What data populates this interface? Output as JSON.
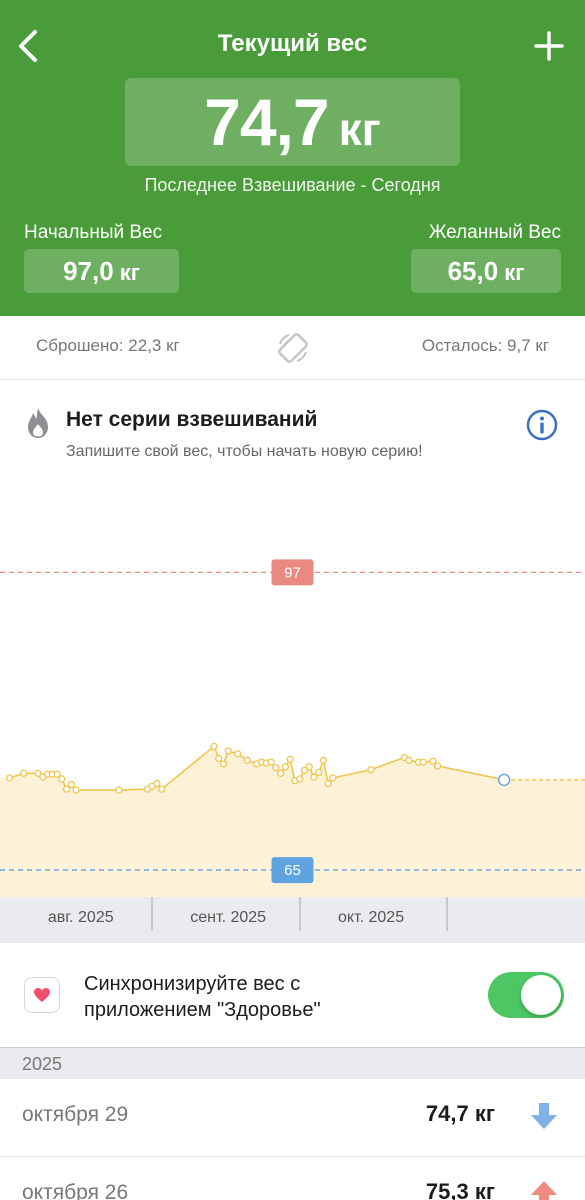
{
  "header": {
    "title": "Текущий вес",
    "current_value": "74,7",
    "current_unit": "кг",
    "last_weigh_in": "Последнее Взвешивание - Сегодня",
    "start_label": "Начальный Вес",
    "start_value": "97,0",
    "start_unit": "кг",
    "goal_label": "Желанный Вес",
    "goal_value": "65,0",
    "goal_unit": "кг",
    "back_icon": "chevron-left-icon",
    "add_icon": "plus-icon"
  },
  "stats": {
    "lost": "Сброшено: 22,3 кг",
    "remaining": "Осталось: 9,7 кг",
    "swap_icon": "swap-icon"
  },
  "streak": {
    "title": "Нет серии взвешиваний",
    "subtitle": "Запишите свой вес, чтобы начать новую серию!",
    "icon": "flame-icon",
    "info_icon": "info-icon"
  },
  "chart_data": {
    "type": "area",
    "start_marker": {
      "label": "97",
      "value": 97,
      "color": "#e88a82"
    },
    "goal_marker": {
      "label": "65",
      "value": 65,
      "color": "#5fa3e0"
    },
    "x_range": [
      "2025-07-15",
      "2025-11-15"
    ],
    "y_range": [
      62,
      108
    ],
    "x_ticks": [
      {
        "label": "авг. 2025",
        "date": "2025-08-01"
      },
      {
        "label": "сент. 2025",
        "date": "2025-09-01"
      },
      {
        "label": "окт. 2025",
        "date": "2025-10-01"
      }
    ],
    "month_dividers": [
      "2025-08-16",
      "2025-09-16",
      "2025-10-17"
    ],
    "line_color": "#f0c550",
    "fill_color": "#fdf1d8",
    "points": [
      {
        "x": "2025-07-17",
        "y": 74.9
      },
      {
        "x": "2025-07-20",
        "y": 75.4
      },
      {
        "x": "2025-07-23",
        "y": 75.4
      },
      {
        "x": "2025-07-24",
        "y": 75.0
      },
      {
        "x": "2025-07-25",
        "y": 75.3
      },
      {
        "x": "2025-07-26",
        "y": 75.3
      },
      {
        "x": "2025-07-27",
        "y": 75.3
      },
      {
        "x": "2025-07-28",
        "y": 74.8
      },
      {
        "x": "2025-07-29",
        "y": 73.7
      },
      {
        "x": "2025-07-30",
        "y": 74.2
      },
      {
        "x": "2025-07-31",
        "y": 73.6
      },
      {
        "x": "2025-08-09",
        "y": 73.6
      },
      {
        "x": "2025-08-15",
        "y": 73.7
      },
      {
        "x": "2025-08-16",
        "y": 74.0
      },
      {
        "x": "2025-08-17",
        "y": 74.3
      },
      {
        "x": "2025-08-18",
        "y": 73.7
      },
      {
        "x": "2025-08-29",
        "y": 78.3
      },
      {
        "x": "2025-08-30",
        "y": 77.0
      },
      {
        "x": "2025-08-31",
        "y": 76.4
      },
      {
        "x": "2025-09-01",
        "y": 77.8
      },
      {
        "x": "2025-09-03",
        "y": 77.5
      },
      {
        "x": "2025-09-05",
        "y": 76.8
      },
      {
        "x": "2025-09-07",
        "y": 76.4
      },
      {
        "x": "2025-09-08",
        "y": 76.6
      },
      {
        "x": "2025-09-09",
        "y": 76.5
      },
      {
        "x": "2025-09-10",
        "y": 76.6
      },
      {
        "x": "2025-09-11",
        "y": 76.0
      },
      {
        "x": "2025-09-12",
        "y": 75.4
      },
      {
        "x": "2025-09-13",
        "y": 76.1
      },
      {
        "x": "2025-09-14",
        "y": 76.9
      },
      {
        "x": "2025-09-15",
        "y": 74.6
      },
      {
        "x": "2025-09-16",
        "y": 74.8
      },
      {
        "x": "2025-09-17",
        "y": 75.7
      },
      {
        "x": "2025-09-18",
        "y": 76.1
      },
      {
        "x": "2025-09-19",
        "y": 75.0
      },
      {
        "x": "2025-09-20",
        "y": 75.5
      },
      {
        "x": "2025-09-21",
        "y": 76.8
      },
      {
        "x": "2025-09-22",
        "y": 74.3
      },
      {
        "x": "2025-09-23",
        "y": 74.9
      },
      {
        "x": "2025-10-01",
        "y": 75.8
      },
      {
        "x": "2025-10-08",
        "y": 77.1
      },
      {
        "x": "2025-10-09",
        "y": 76.8
      },
      {
        "x": "2025-10-11",
        "y": 76.6
      },
      {
        "x": "2025-10-12",
        "y": 76.6
      },
      {
        "x": "2025-10-14",
        "y": 76.7
      },
      {
        "x": "2025-10-15",
        "y": 76.2
      },
      {
        "x": "2025-10-29",
        "y": 74.7
      }
    ]
  },
  "sync": {
    "text": "Синхронизируйте вес с приложением \"Здоровье\"",
    "enabled": true,
    "icon": "heart-icon"
  },
  "history": {
    "year": "2025",
    "entries": [
      {
        "date": "октября 29",
        "weight": "74,7 кг",
        "trend": "down",
        "trend_icon": "arrow-down-icon",
        "color": "#7fb1e6"
      },
      {
        "date": "октября 26",
        "weight": "75,3 кг",
        "trend": "up",
        "trend_icon": "arrow-up-icon",
        "color": "#ef8a80"
      }
    ]
  },
  "colors": {
    "header_green": "#4a9c3a",
    "toggle_green": "#4cc764",
    "info_blue": "#3a6fc4"
  }
}
